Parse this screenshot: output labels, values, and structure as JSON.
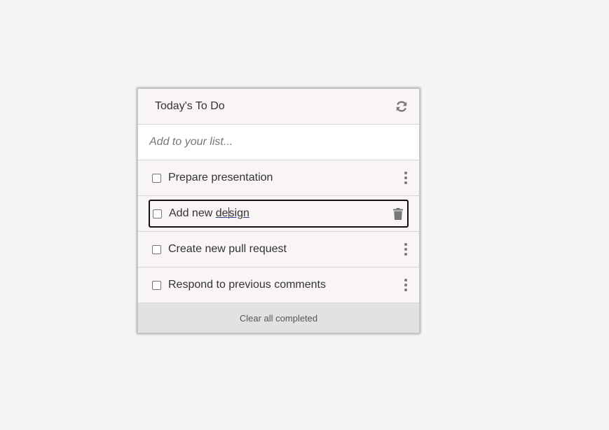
{
  "header": {
    "title": "Today's To Do",
    "refresh_icon": "refresh-icon"
  },
  "add": {
    "placeholder": "Add to your list..."
  },
  "items": [
    {
      "label": "Prepare presentation",
      "checked": false,
      "action_icon": "more-vertical-icon"
    },
    {
      "label_before": "Add new ",
      "label_mid_a": "de",
      "label_mid_b": "sign",
      "checked": false,
      "editing": true,
      "action_icon": "trash-icon"
    },
    {
      "label": "Create new pull request",
      "checked": false,
      "action_icon": "more-vertical-icon"
    },
    {
      "label": "Respond to previous comments",
      "checked": false,
      "action_icon": "more-vertical-icon"
    }
  ],
  "footer": {
    "clear_label": "Clear all completed"
  },
  "colors": {
    "background": "#f5f5f5",
    "card": "#f8f5f4",
    "footer": "#e2e2e2",
    "icon": "#777777"
  }
}
